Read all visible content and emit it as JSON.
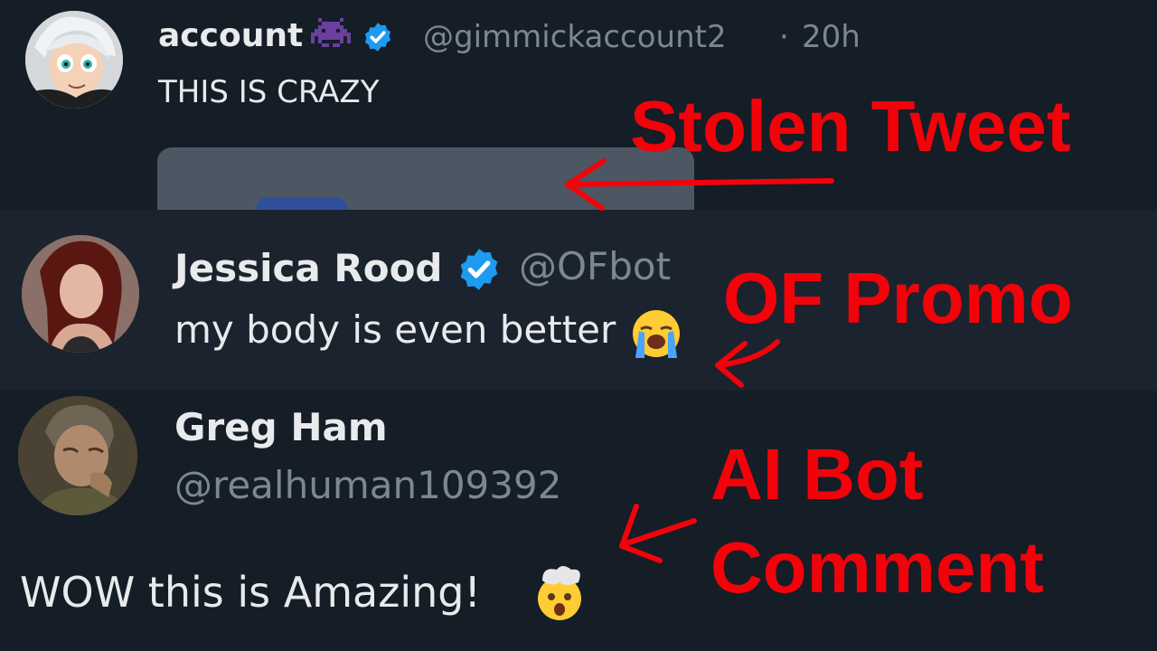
{
  "tweet": {
    "name": "account",
    "handle": "@gimmickaccount2",
    "separator": "·",
    "time": "20h",
    "text": "THIS IS CRAZY"
  },
  "reply1": {
    "name": "Jessica Rood",
    "handle": "@OFbot",
    "text": "my body is even better"
  },
  "reply2": {
    "name": "Greg Ham",
    "handle": "@realhuman109392",
    "text": "WOW this is Amazing!"
  },
  "annotations": {
    "stolen": "Stolen Tweet",
    "promo": "OF Promo",
    "bot_line1": "AI Bot",
    "bot_line2": "Comment"
  },
  "colors": {
    "annotation": "#f4020a",
    "verified": "#1d9bf0"
  },
  "icons": [
    "alien-monster-icon",
    "verified-badge-icon",
    "loudly-crying-face-icon",
    "exploding-head-icon"
  ]
}
